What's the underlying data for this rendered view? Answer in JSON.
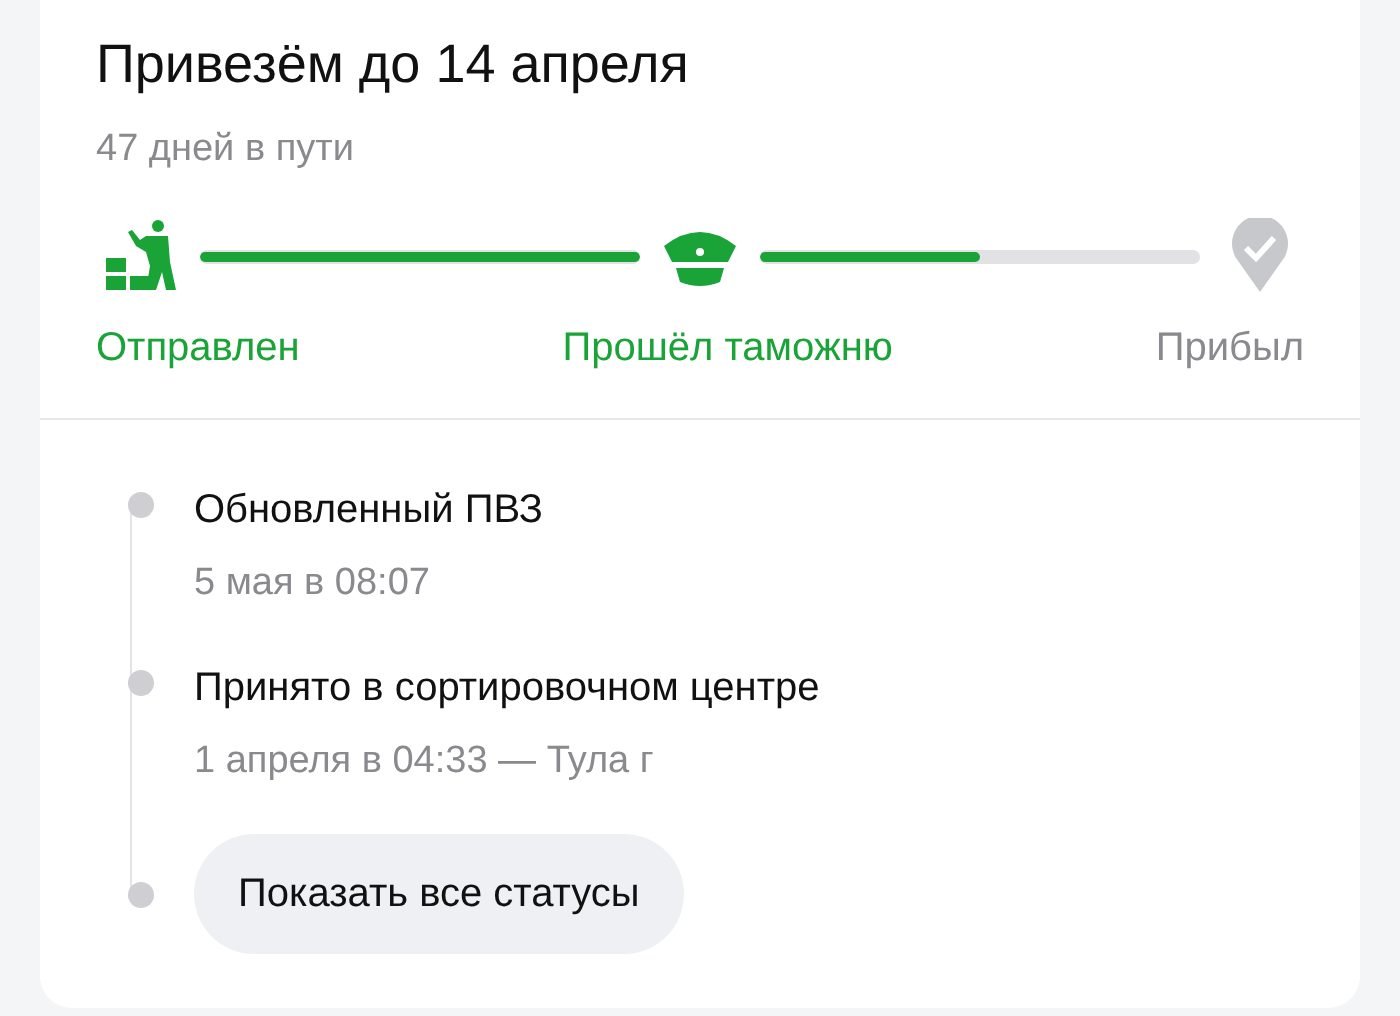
{
  "header": {
    "title": "Привезём до 14 апреля",
    "subtitle": "47 дней в пути"
  },
  "stages": [
    {
      "kind": "shipped",
      "label": "Отправлен",
      "done": true
    },
    {
      "kind": "customs",
      "label": "Прошёл таможню",
      "done": true
    },
    {
      "kind": "arrived",
      "label": "Прибыл",
      "done": false
    }
  ],
  "segments": [
    {
      "level": 1
    },
    {
      "level": 0.5
    }
  ],
  "events": [
    {
      "title": "Обновленный ПВЗ",
      "detail": "5 мая в 08:07"
    },
    {
      "title": "Принято в сортировочном центре",
      "detail": "1 апреля в 04:33 — Тула г"
    }
  ],
  "show_all_button": "Показать все статусы"
}
